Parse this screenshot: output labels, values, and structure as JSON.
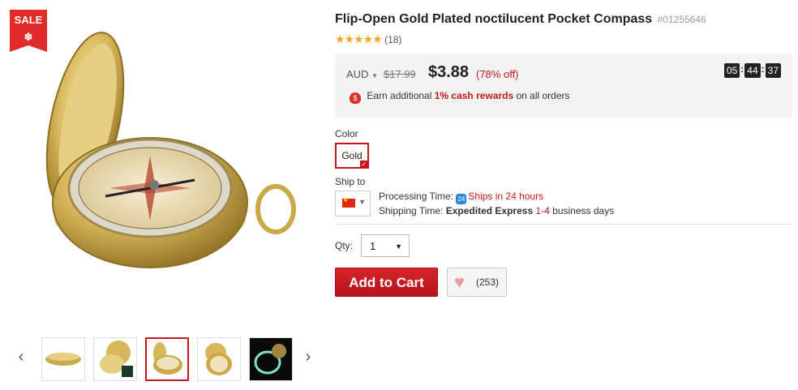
{
  "badge": {
    "sale": "SALE",
    "icon": "snowflake-icon"
  },
  "product": {
    "title": "Flip-Open Gold Plated noctilucent Pocket Compass",
    "sku": "#01255646",
    "rating_stars": "★★★★★",
    "rating_count": "(18)"
  },
  "price": {
    "currency": "AUD",
    "original": "$17.99",
    "current": "$3.88",
    "discount": "(78% off)",
    "timer": {
      "h": "05",
      "m": "44",
      "s": "37"
    },
    "cash_text_pre": "Earn additional ",
    "cash_highlight": "1% cash rewards",
    "cash_text_post": " on all orders"
  },
  "color": {
    "label": "Color",
    "selected": "Gold"
  },
  "ship": {
    "label": "Ship to",
    "processing_label": "Processing Time:",
    "processing_value": "Ships in 24 hours",
    "shipping_label": "Shipping Time:",
    "shipping_method": "Expedited Express",
    "shipping_days": "1-4",
    "shipping_suffix": " business days"
  },
  "qty": {
    "label": "Qty:",
    "value": "1"
  },
  "actions": {
    "add_to_cart": "Add to Cart",
    "wishlist_count": "(253)"
  },
  "gallery": {
    "prev": "‹",
    "next": "›"
  },
  "colors": {
    "accent": "#c4161c",
    "sale": "#e02b2b",
    "gold": "#c9a94a",
    "timer_bg": "#222222"
  }
}
